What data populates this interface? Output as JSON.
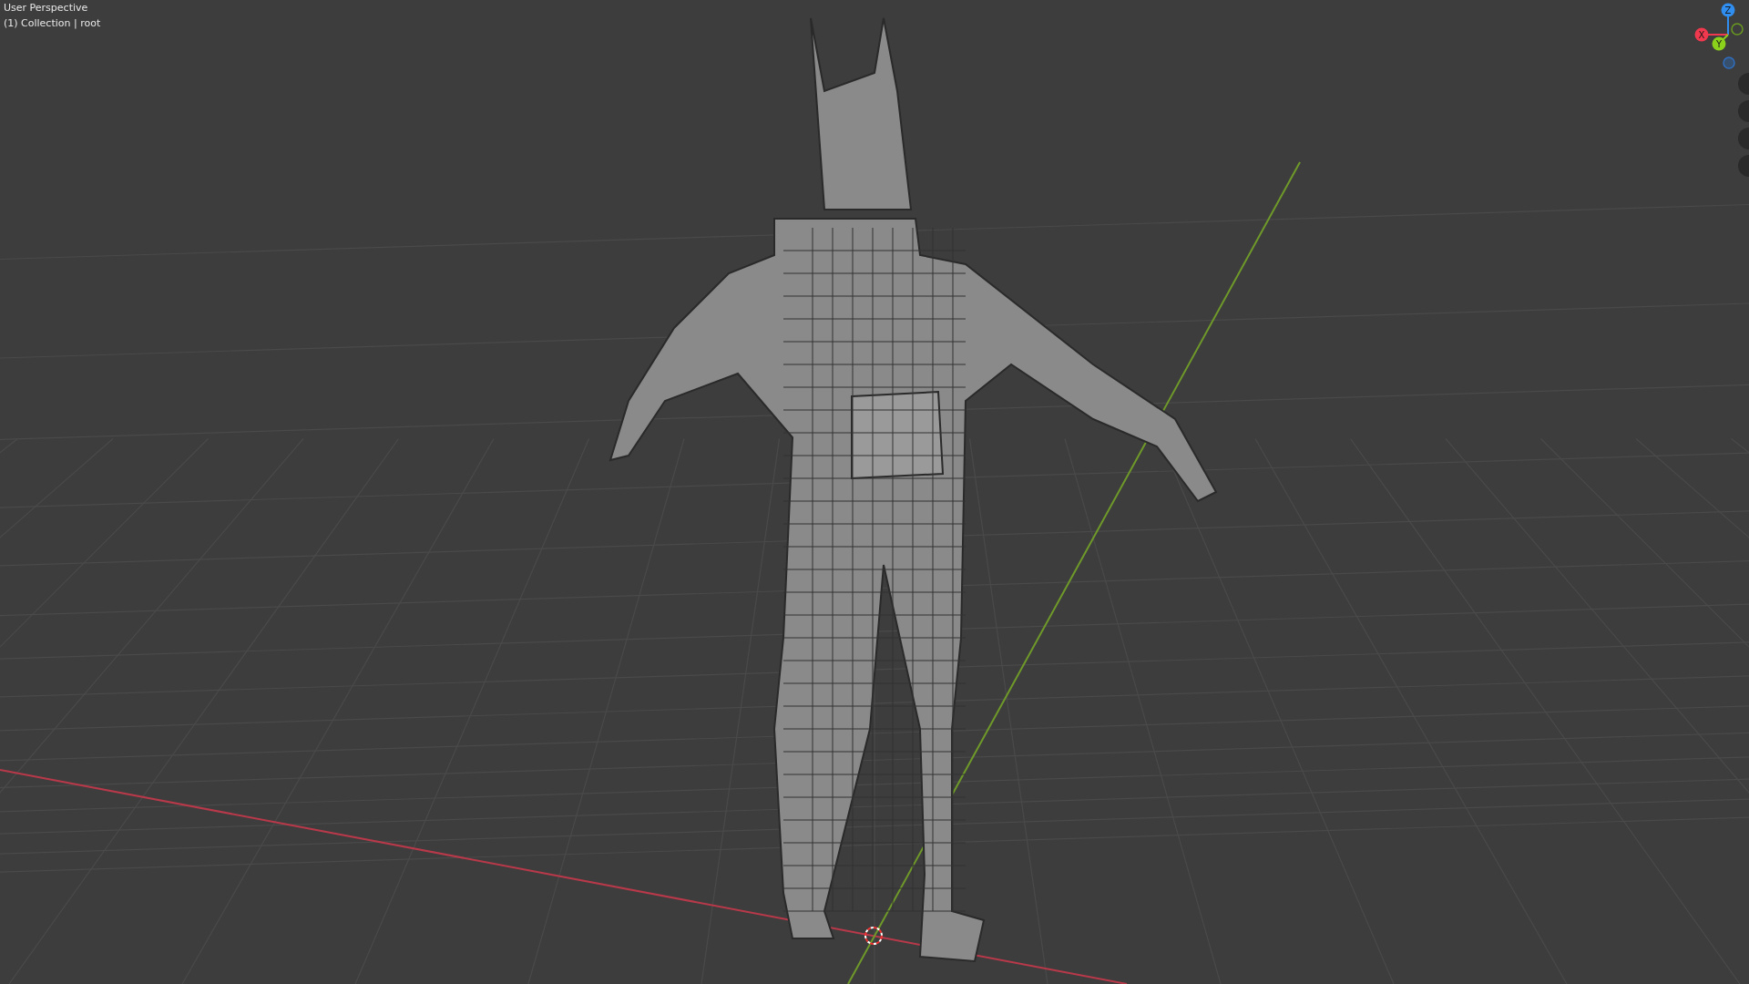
{
  "viewport": {
    "mode_label": "User Perspective",
    "collection_label": "(1) Collection | root"
  },
  "gizmo": {
    "axes": [
      {
        "label": "Z",
        "color": "#2f8ef0"
      },
      {
        "label": "X",
        "color": "#f0384e"
      },
      {
        "label": "Y",
        "color": "#8bd01a"
      }
    ]
  }
}
